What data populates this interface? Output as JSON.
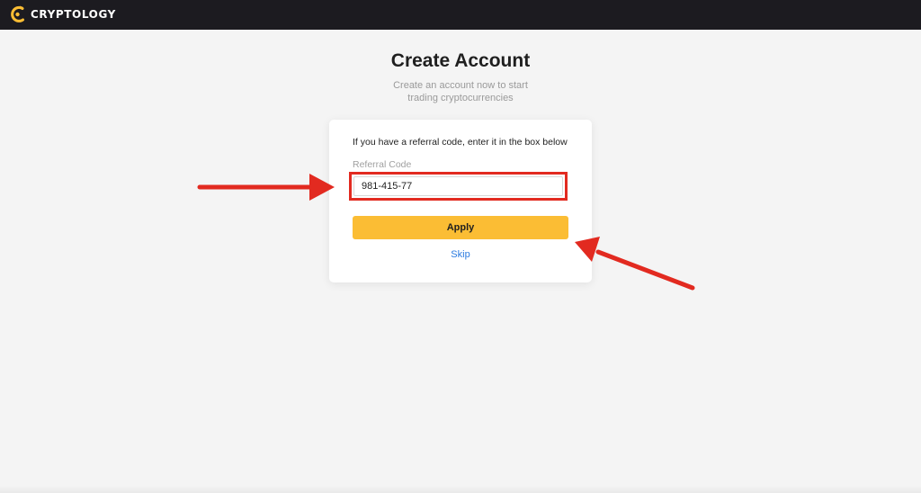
{
  "header": {
    "brand_name": "CRYPTOLOGY",
    "brand_icon": "cryptology-logo-icon",
    "background_color": "#1c1b20",
    "brand_icon_color": "#fbbd34"
  },
  "main": {
    "title": "Create Account",
    "subtitle_line1": "Create an account now to start",
    "subtitle_line2": "trading cryptocurrencies"
  },
  "referral_card": {
    "instruction": "If you have a referral code, enter it in the box below",
    "field_label": "Referral Code",
    "field_value": "981-415-77",
    "apply_label": "Apply",
    "skip_label": "Skip",
    "apply_color": "#fbbd34",
    "skip_color": "#2b7be0"
  },
  "annotations": {
    "highlight_color": "#e22a20",
    "arrows": [
      "arrow-right-icon",
      "arrow-up-left-icon"
    ]
  }
}
